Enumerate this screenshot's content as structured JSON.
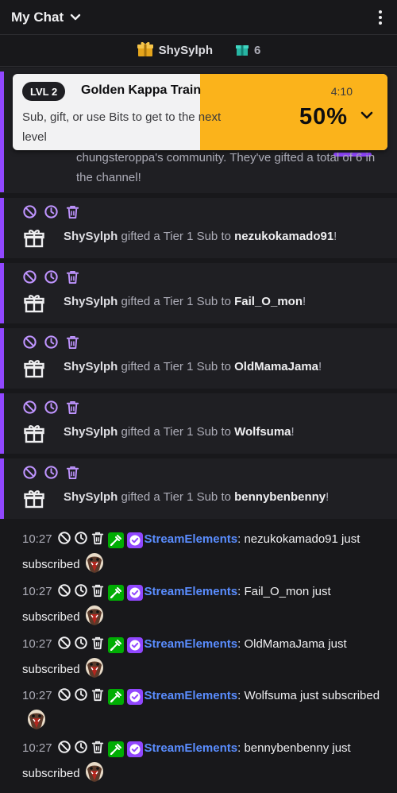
{
  "header": {
    "title": "My Chat"
  },
  "leaderboard": {
    "top_gifter": "ShySylph",
    "gift_count": "6"
  },
  "hype_train": {
    "level": "LVL 2",
    "title": "Golden Kappa Train",
    "subtitle": "Sub, gift, or use Bits to get to the next level",
    "timer": "4:10",
    "progress_label": "50%",
    "progress": 0.5
  },
  "behind_text": "chungsteroppa's community. They've gifted a total of 6 in the channel!",
  "gift_notices": [
    {
      "gifter": "ShySylph",
      "middle": " gifted a Tier 1 Sub to ",
      "recipient": "nezukokamado91",
      "end": "!"
    },
    {
      "gifter": "ShySylph",
      "middle": " gifted a Tier 1 Sub to ",
      "recipient": "Fail_O_mon",
      "end": "!"
    },
    {
      "gifter": "ShySylph",
      "middle": " gifted a Tier 1 Sub to ",
      "recipient": "OldMamaJama",
      "end": "!"
    },
    {
      "gifter": "ShySylph",
      "middle": " gifted a Tier 1 Sub to ",
      "recipient": "Wolfsuma",
      "end": "!"
    },
    {
      "gifter": "ShySylph",
      "middle": " gifted a Tier 1 Sub to ",
      "recipient": "bennybenbenny",
      "end": "!"
    }
  ],
  "chat_messages": [
    {
      "time": "10:27",
      "user": "StreamElements",
      "sep": ": ",
      "text": "nezukokamado91 just subscribed"
    },
    {
      "time": "10:27",
      "user": "StreamElements",
      "sep": ": ",
      "text": "Fail_O_mon just subscribed"
    },
    {
      "time": "10:27",
      "user": "StreamElements",
      "sep": ": ",
      "text": "OldMamaJama just subscribed"
    },
    {
      "time": "10:27",
      "user": "StreamElements",
      "sep": ": ",
      "text": "Wolfsuma just subscribed"
    },
    {
      "time": "10:27",
      "user": "StreamElements",
      "sep": ": ",
      "text": "bennybenbenny just subscribed"
    }
  ],
  "colors": {
    "accent": "#9147ff",
    "hype_fill": "#fbb31b",
    "username": "#5a8dff",
    "mod_badge": "#00ad03"
  }
}
